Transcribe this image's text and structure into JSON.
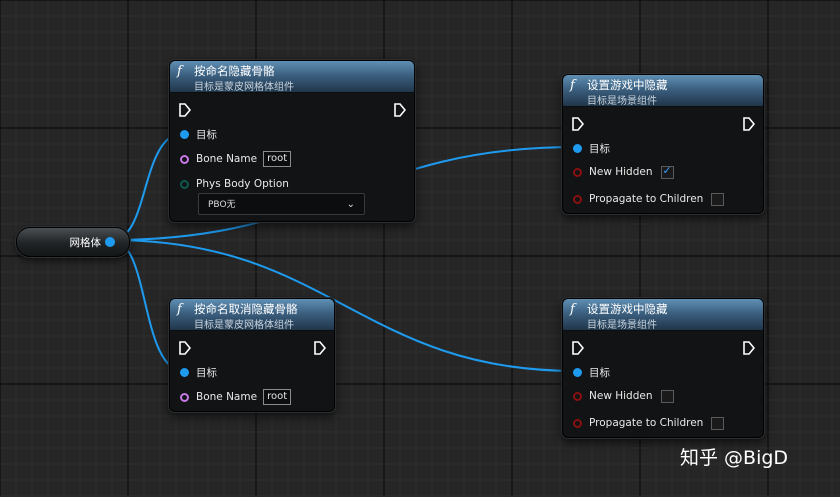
{
  "canvas": {
    "background": "#262626",
    "grid_color": "#1a1a1a"
  },
  "accent_colors": {
    "object_pin": "#1e9bef",
    "name_pin": "#c779e6",
    "bool_pin": "#8a1010",
    "wire": "#1e9bef"
  },
  "variable_node": {
    "label": "网格体"
  },
  "nodes": {
    "hide_bone": {
      "icon": "function-icon",
      "title": "按命名隐藏骨骼",
      "subtitle": "目标是蒙皮网格体组件",
      "target_label": "目标",
      "bone_name_label": "Bone Name",
      "bone_name_value": "root",
      "phys_body_label": "Phys Body Option",
      "phys_body_value": "PBO无"
    },
    "set_hidden_1": {
      "icon": "function-icon",
      "title": "设置游戏中隐藏",
      "subtitle": "目标是场景组件",
      "target_label": "目标",
      "new_hidden_label": "New Hidden",
      "new_hidden_checked": true,
      "propagate_label": "Propagate to Children",
      "propagate_checked": false
    },
    "unhide_bone": {
      "icon": "function-icon",
      "title": "按命名取消隐藏骨骼",
      "subtitle": "目标是蒙皮网格体组件",
      "target_label": "目标",
      "bone_name_label": "Bone Name",
      "bone_name_value": "root"
    },
    "set_hidden_2": {
      "icon": "function-icon",
      "title": "设置游戏中隐藏",
      "subtitle": "目标是场景组件",
      "target_label": "目标",
      "new_hidden_label": "New Hidden",
      "new_hidden_checked": false,
      "propagate_label": "Propagate to Children",
      "propagate_checked": false
    }
  },
  "watermark": "知乎 @BigD"
}
